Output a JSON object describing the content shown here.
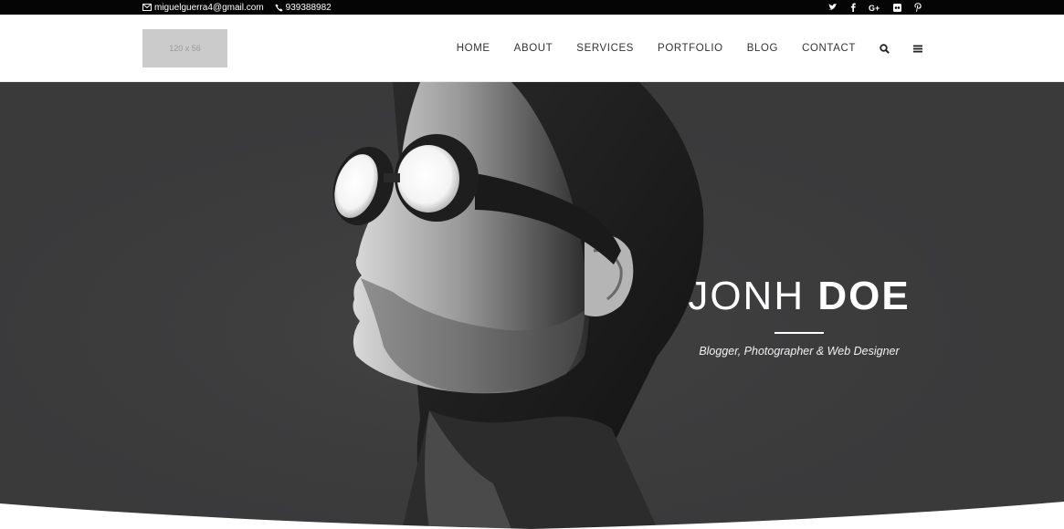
{
  "topbar": {
    "email": "miguelguerra4@gmail.com",
    "phone": "939388982",
    "social": [
      "twitter-icon",
      "facebook-icon",
      "google-plus-icon",
      "flickr-icon",
      "pinterest-icon"
    ]
  },
  "header": {
    "logo_placeholder": "120 x 56",
    "nav": [
      "HOME",
      "ABOUT",
      "SERVICES",
      "PORTFOLIO",
      "BLOG",
      "CONTACT"
    ]
  },
  "hero": {
    "first_name": "JONH",
    "last_name": "DOE",
    "subtitle": "Blogger, Photographer & Web Designer"
  },
  "colors": {
    "topbar_bg": "#050505",
    "hero_bg": "#3a3a3b",
    "text_dark": "#333333"
  }
}
